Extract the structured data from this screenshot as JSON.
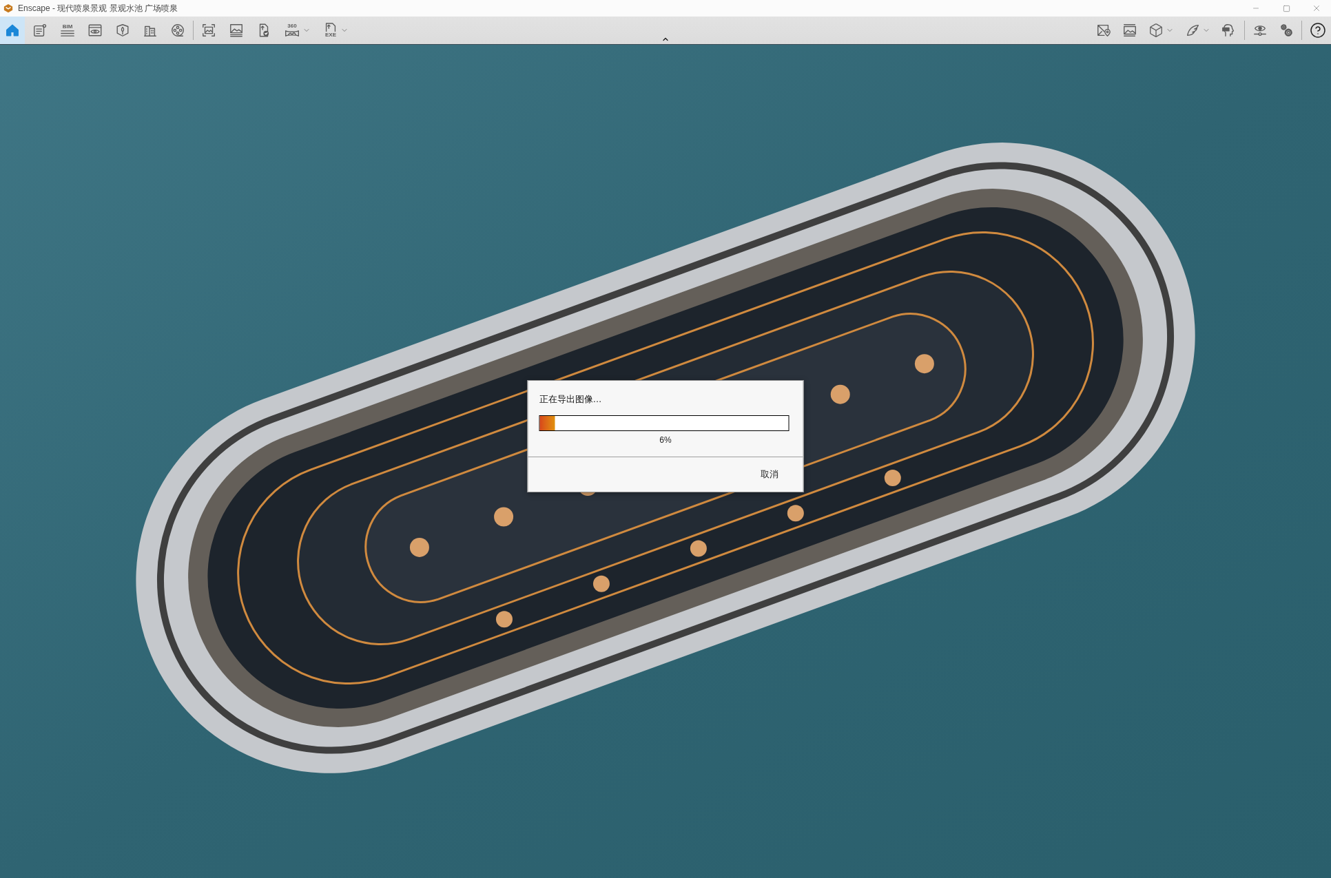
{
  "window": {
    "title": "Enscape - 现代喷泉景观 景观水池 广场喷泉"
  },
  "toolbar": {
    "left_groups": [
      [
        {
          "selected": true,
          "dropdown": false
        },
        {
          "selected": false,
          "dropdown": false
        },
        {
          "selected": false,
          "dropdown": false,
          "label": "BIM"
        },
        {
          "selected": false,
          "dropdown": false
        },
        {
          "selected": false,
          "dropdown": false
        },
        {
          "selected": false,
          "dropdown": false
        },
        {
          "selected": false,
          "dropdown": false
        }
      ],
      [
        {
          "selected": false,
          "dropdown": false
        },
        {
          "selected": false,
          "dropdown": false
        },
        {
          "selected": false,
          "dropdown": false
        },
        {
          "selected": false,
          "dropdown": true,
          "label": "360"
        },
        {
          "selected": false,
          "dropdown": true,
          "label": "EXE"
        }
      ]
    ],
    "right_groups": [
      [
        {
          "selected": false,
          "dropdown": false
        },
        {
          "selected": false,
          "dropdown": false
        },
        {
          "selected": false,
          "dropdown": true
        },
        {
          "selected": false,
          "dropdown": true
        },
        {
          "selected": false,
          "dropdown": false
        }
      ],
      [
        {
          "selected": false,
          "dropdown": false
        },
        {
          "selected": false,
          "dropdown": false
        }
      ],
      [
        {
          "selected": false,
          "dropdown": false
        }
      ]
    ]
  },
  "dialog": {
    "title": "正在导出图像…",
    "progress": {
      "level": 0.06,
      "reading": "6%"
    },
    "buttons": [
      "取消"
    ]
  }
}
